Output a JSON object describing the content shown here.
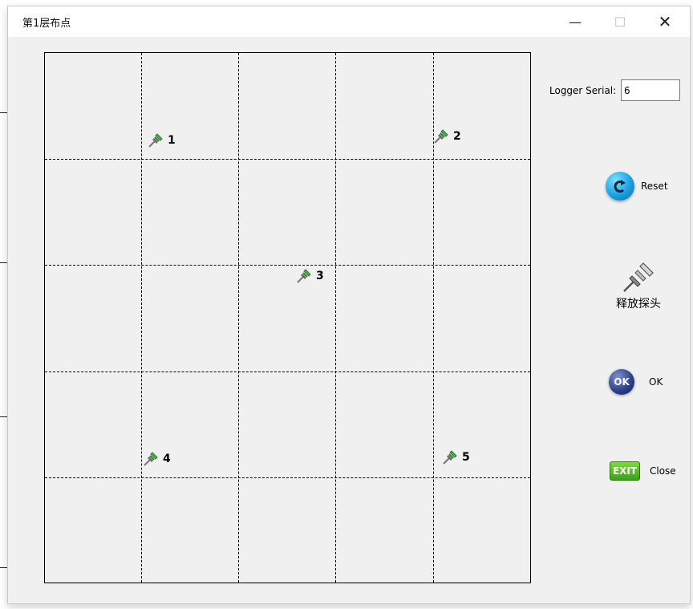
{
  "window": {
    "title": "第1层布点",
    "minimize_glyph": "—",
    "maximize_glyph": "☐",
    "close_glyph": "✕"
  },
  "probes": [
    {
      "label": "1",
      "icon": "pushpin-icon"
    },
    {
      "label": "2",
      "icon": "pushpin-icon"
    },
    {
      "label": "3",
      "icon": "pushpin-icon"
    },
    {
      "label": "4",
      "icon": "pushpin-icon"
    },
    {
      "label": "5",
      "icon": "pushpin-icon"
    }
  ],
  "serial": {
    "label": "Logger Serial:",
    "value": "6"
  },
  "buttons": {
    "reset_label": "Reset",
    "release_label": "释放探头",
    "ok_label": "OK",
    "ok_icon_text": "OK",
    "close_label": "Close",
    "exit_icon_text": "EXIT"
  },
  "colors": {
    "pin_head": "#4caf50",
    "reset_blue": "#1a9fe0",
    "ok_navy": "#2b3d86",
    "exit_green": "#3a9f1a"
  }
}
